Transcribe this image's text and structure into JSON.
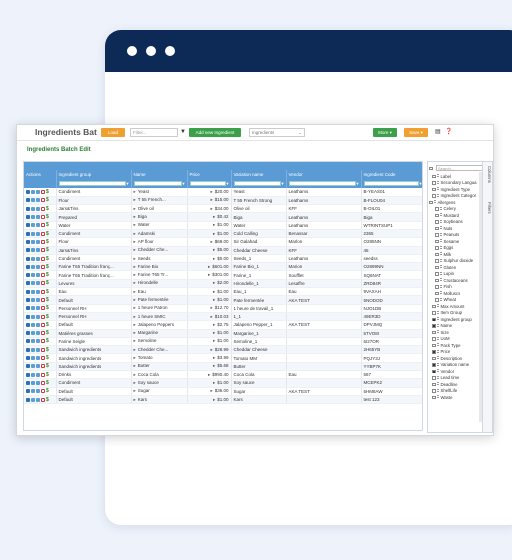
{
  "toolbar": {
    "title": "Ingredients Bat",
    "load_label": "Load",
    "filter_placeholder": "Filter...",
    "add_label": "Add new Ingredient",
    "select_value": "Ingredients",
    "more_label": "More ▾",
    "save_label": "Save ▾"
  },
  "subtitle": "Ingredients Batch Edit",
  "columns": [
    "Actions",
    "Ingredient group",
    "Name",
    "Price",
    "Variation name",
    "Vendor",
    "Ingredient Code"
  ],
  "rows": [
    [
      "Condiment",
      "Yeast",
      "$20.00",
      "Yeast",
      "Leathams",
      "B-YEAS01"
    ],
    [
      "Flour",
      "T 55 French...",
      "$15.00",
      "T 55 French Strong",
      "Leathams",
      "B-FLOU04"
    ],
    [
      "Jars&Tins",
      "Olive oil",
      "$34.00",
      "Olive oil",
      "KFF",
      "B-OIL01"
    ],
    [
      "Prepared",
      "Biga",
      "$0.42",
      "Biga",
      "Leathams",
      "Biga"
    ],
    [
      "Water",
      "Water",
      "$1.00",
      "Water",
      "Leathams",
      "WTRINTSUP1"
    ],
    [
      "Condiment",
      "Adamski",
      "$1.00",
      "Cold Calling",
      "Benassar",
      "2365"
    ],
    [
      "Flour",
      "AP flour",
      "$68.00",
      "Sir Galahad",
      "Marlon",
      "O285NN"
    ],
    [
      "Jars&Tins",
      "Chedder Che...",
      "$5.00",
      "Cheddar Cheese",
      "KFF",
      "45"
    ],
    [
      "Condiment",
      "Seeds",
      "$0.00",
      "Seeds_1",
      "Leathams",
      "seedss"
    ],
    [
      "Farine T65 Tradition franç...",
      "Farine Bio",
      "$601.00",
      "Farine Bio_1",
      "Marion",
      "O2899NN"
    ],
    [
      "Farine T65 Tradition franç...",
      "Farine T65 Tr...",
      "$301.00",
      "Farine_1",
      "Soufflet",
      "SQ6NAT"
    ],
    [
      "Levures",
      "Hirondelle",
      "$2.00",
      "Hirondelle_1",
      "Lesaffre",
      "ZRD84R"
    ],
    [
      "Eau",
      "Eau",
      "$1.00",
      "Eau_1",
      "Eau",
      "9VAXAH"
    ],
    [
      "Default",
      "Pate fermentée",
      "$1.00",
      "Pate fermentée",
      "AKA TEST",
      "5NODOD"
    ],
    [
      "Personnel RH",
      "1 heure Patron",
      "$12.70",
      "1 heure de travail_1",
      "",
      "NJO1DB"
    ],
    [
      "Personnel RH",
      "1 heure SMIC",
      "$10.03",
      "1_1",
      "",
      "49ER3D"
    ],
    [
      "Default",
      "Jalapeno Peppers",
      "$2.75",
      "Jalapeno Pepper_1",
      "AKA TEST",
      "DPVJMQ"
    ],
    [
      "Matières grasses",
      "Margarine",
      "$1.00",
      "Margarine_1",
      "",
      "5TVO8I"
    ],
    [
      "Farine Seigle",
      "Semoline",
      "$1.00",
      "Semoline_1",
      "",
      "6I27OR"
    ],
    [
      "Sandwich ingredients",
      "Chedder Che...",
      "$28.99",
      "Cheddar Cheese",
      "",
      "2H65YB"
    ],
    [
      "Sandwich ingredients",
      "Tomato",
      "$3.99",
      "Tomato MM",
      "",
      "PQJY3J"
    ],
    [
      "Sandwich ingredients",
      "Butter",
      "$5.68",
      "Butter",
      "",
      "YYBP7K"
    ],
    [
      "Drinks",
      "Coca Cola",
      "$990.40",
      "Coca Cola",
      "Eau",
      "567"
    ],
    [
      "Condiment",
      "Soy sauce",
      "$1.00",
      "Soy sauce",
      "",
      "MCEPK2"
    ],
    [
      "Default",
      "Sugar",
      "$36.00",
      "Sugar",
      "AKA TEST",
      "5HM8AW"
    ],
    [
      "Default",
      "Kars",
      "$1.00",
      "Kars",
      "",
      "test 123"
    ]
  ],
  "side_panel": {
    "search_placeholder": "Search...",
    "tabs": [
      "Columns",
      "Filters"
    ],
    "items": [
      {
        "label": "Label",
        "checked": false,
        "indent": 1
      },
      {
        "label": "Secondary Langua",
        "checked": false,
        "indent": 1
      },
      {
        "label": "Ingredient Type",
        "checked": false,
        "indent": 1
      },
      {
        "label": "Ingredient Categor",
        "checked": false,
        "indent": 1
      },
      {
        "label": "Allergens",
        "checked": false,
        "indent": 0
      },
      {
        "label": "Celery",
        "checked": false,
        "indent": 2
      },
      {
        "label": "Mustard",
        "checked": false,
        "indent": 2
      },
      {
        "label": "Soybeans",
        "checked": false,
        "indent": 2
      },
      {
        "label": "Nuts",
        "checked": false,
        "indent": 2
      },
      {
        "label": "Peanuts",
        "checked": false,
        "indent": 2
      },
      {
        "label": "Sesame",
        "checked": false,
        "indent": 2
      },
      {
        "label": "Eggs",
        "checked": false,
        "indent": 2
      },
      {
        "label": "Milk",
        "checked": false,
        "indent": 2
      },
      {
        "label": "Sulphur dioxide",
        "checked": false,
        "indent": 2
      },
      {
        "label": "Gluten",
        "checked": false,
        "indent": 2
      },
      {
        "label": "Lupin",
        "checked": false,
        "indent": 2
      },
      {
        "label": "Crustaceans",
        "checked": false,
        "indent": 2
      },
      {
        "label": "Fish",
        "checked": false,
        "indent": 2
      },
      {
        "label": "Molluscs",
        "checked": false,
        "indent": 2
      },
      {
        "label": "Wheat",
        "checked": false,
        "indent": 2
      },
      {
        "label": "Max Amount",
        "checked": false,
        "indent": 1
      },
      {
        "label": "Item Group",
        "checked": false,
        "indent": 1
      },
      {
        "label": "Ingredient group",
        "checked": true,
        "indent": 1
      },
      {
        "label": "Name",
        "checked": true,
        "indent": 1
      },
      {
        "label": "Size",
        "checked": false,
        "indent": 1
      },
      {
        "label": "UoM",
        "checked": false,
        "indent": 1
      },
      {
        "label": "Pack Type",
        "checked": false,
        "indent": 1
      },
      {
        "label": "Price",
        "checked": true,
        "indent": 1
      },
      {
        "label": "Description",
        "checked": false,
        "indent": 1
      },
      {
        "label": "Variation name",
        "checked": true,
        "indent": 1
      },
      {
        "label": "Vendor",
        "checked": true,
        "indent": 1
      },
      {
        "label": "Lead time",
        "checked": false,
        "indent": 1
      },
      {
        "label": "Deadline",
        "checked": false,
        "indent": 1
      },
      {
        "label": "ShelfLife",
        "checked": false,
        "indent": 1
      },
      {
        "label": "Waste",
        "checked": false,
        "indent": 1
      }
    ]
  }
}
